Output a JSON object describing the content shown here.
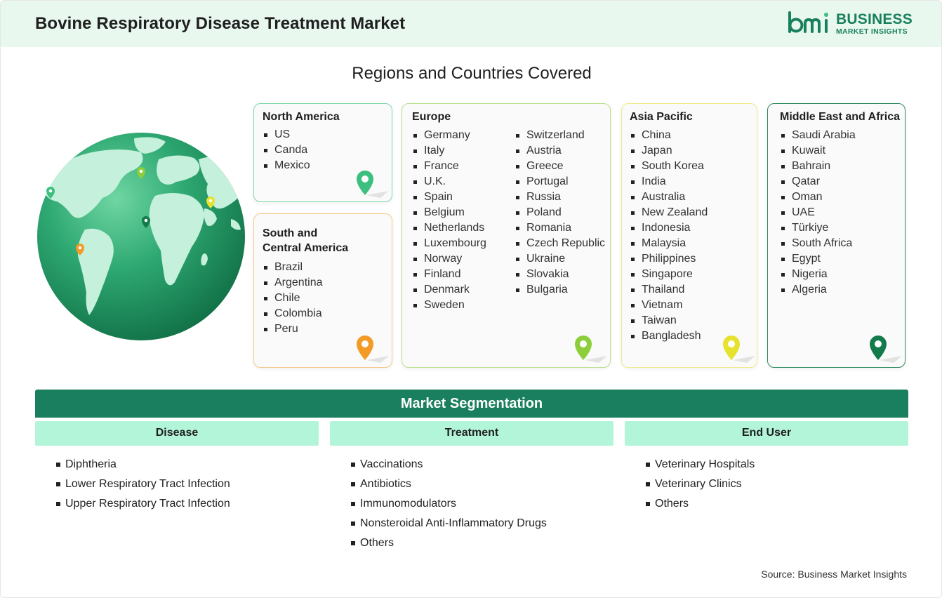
{
  "header": {
    "title": "Bovine Respiratory Disease Treatment Market",
    "logo_line1": "BUSINESS",
    "logo_line2": "MARKET INSIGHTS",
    "logo_mark": "bmi"
  },
  "regions_title": "Regions and Countries Covered",
  "regions": {
    "north_america": {
      "title": "North America",
      "countries": [
        "US",
        "Canda",
        "Mexico"
      ],
      "pin_color": "#3dbf7f"
    },
    "south_central_america": {
      "title_line1": "South and",
      "title_line2": "Central America",
      "countries": [
        "Brazil",
        "Argentina",
        "Chile",
        "Colombia",
        "Peru"
      ],
      "pin_color": "#f29b26"
    },
    "europe": {
      "title": "Europe",
      "countries_col1": [
        "Germany",
        "Italy",
        "France",
        "U.K.",
        "Spain",
        "Belgium",
        "Netherlands",
        "Luxembourg",
        "Norway",
        "Finland",
        "Denmark",
        "Sweden"
      ],
      "countries_col2": [
        "Switzerland",
        "Austria",
        "Greece",
        "Portugal",
        "Russia",
        "Poland",
        "Romania",
        "Czech Republic",
        "Ukraine",
        "Slovakia",
        "Bulgaria"
      ],
      "pin_color": "#8ccf3a"
    },
    "asia_pacific": {
      "title": "Asia Pacific",
      "countries": [
        "China",
        "Japan",
        "South Korea",
        "India",
        "Australia",
        "New Zealand",
        "Indonesia",
        "Malaysia",
        "Philippines",
        "Singapore",
        "Thailand",
        "Vietnam",
        "Taiwan",
        "Bangladesh"
      ],
      "pin_color": "#e6e22e"
    },
    "middle_east_africa": {
      "title": "Middle East and Africa",
      "countries": [
        "Saudi Arabia",
        "Kuwait",
        "Bahrain",
        "Qatar",
        "Oman",
        "UAE",
        "Türkiye",
        "South Africa",
        "Egypt",
        "Nigeria",
        "Algeria"
      ],
      "pin_color": "#137a4c"
    }
  },
  "segmentation": {
    "title": "Market Segmentation",
    "columns": [
      {
        "header": "Disease",
        "items": [
          "Diphtheria",
          "Lower Respiratory Tract Infection",
          "Upper Respiratory Tract Infection"
        ]
      },
      {
        "header": "Treatment",
        "items": [
          "Vaccinations",
          "Antibiotics",
          "Immunomodulators",
          "Nonsteroidal Anti-Inflammatory Drugs",
          "Others"
        ]
      },
      {
        "header": "End User",
        "items": [
          "Veterinary Hospitals",
          "Veterinary Clinics",
          "Others"
        ]
      }
    ]
  },
  "source": "Source: Business Market Insights",
  "colors": {
    "brand_green": "#1a7f5e",
    "header_bg": "#e8f8ef",
    "segment_header_bg": "#b3f5d9",
    "north_america_border": "#7fd8a8",
    "south_central_america_border": "#f5c68a",
    "europe_border": "#b9e08e",
    "asia_pacific_border": "#eeea8a",
    "middle_east_africa_border": "#2f8a5f"
  }
}
